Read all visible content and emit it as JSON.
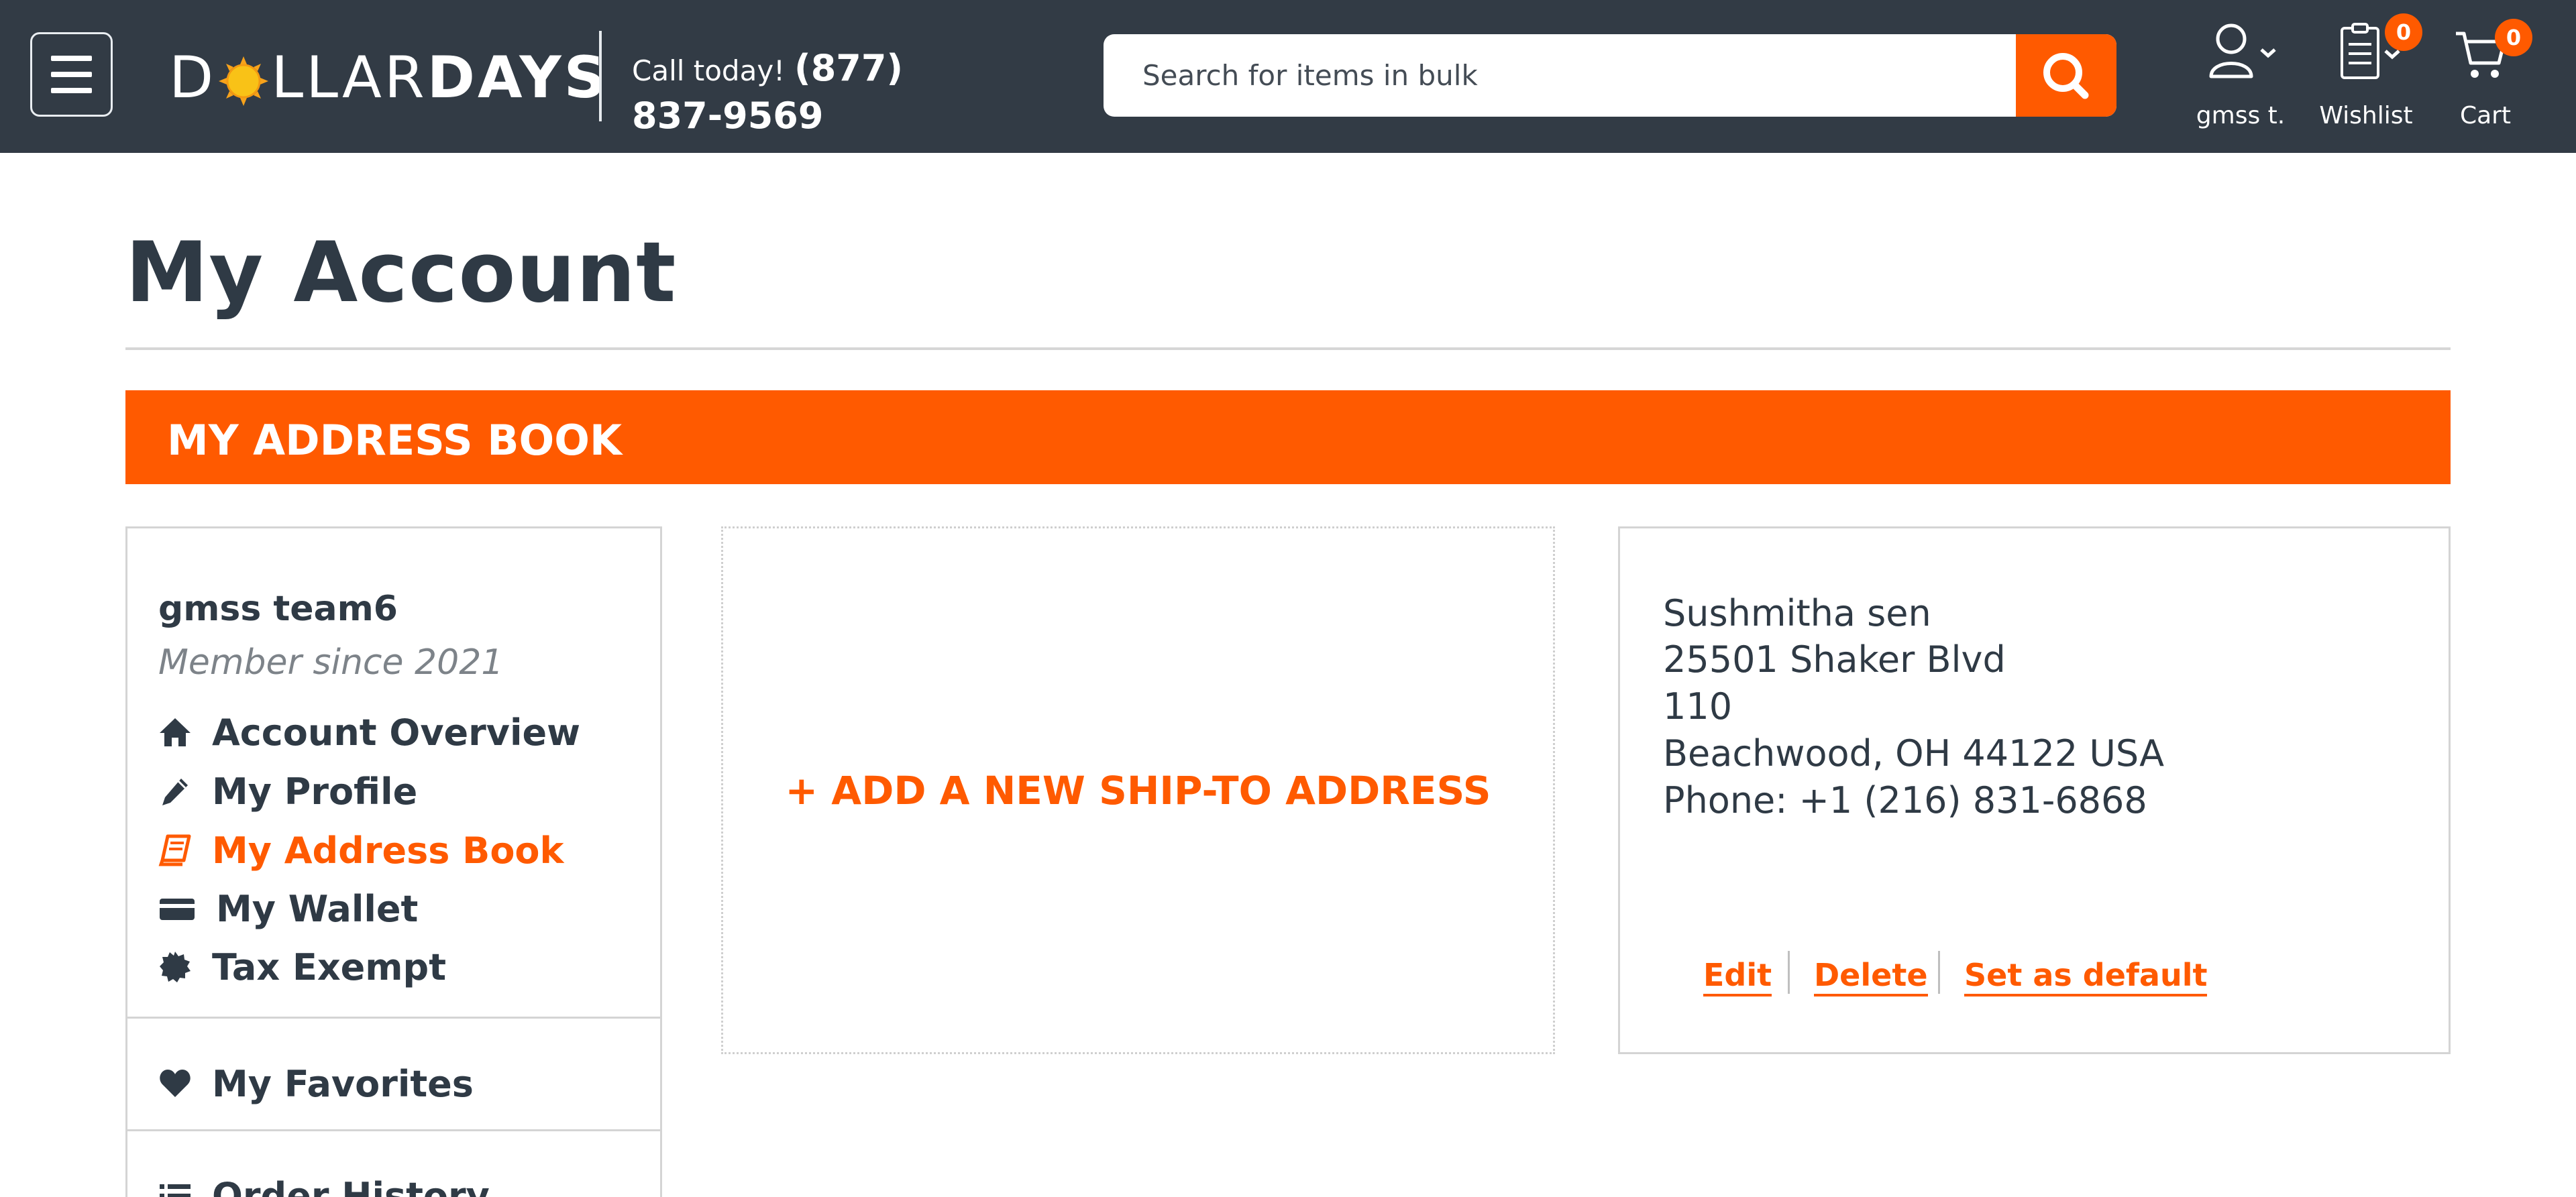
{
  "header": {
    "logo": {
      "part1": "D",
      "part2": "LLAR",
      "part3": "DAYS"
    },
    "call_label": "Call today!",
    "phone_part1": "(877)",
    "phone_part2": "837-9569",
    "search": {
      "placeholder": "Search for items in bulk"
    },
    "account_label": "gmss t.",
    "wishlist_label": "Wishlist",
    "wishlist_count": "0",
    "cart_label": "Cart",
    "cart_count": "0"
  },
  "page": {
    "title": "My Account",
    "section_title": "MY ADDRESS BOOK"
  },
  "sidebar": {
    "user_name": "gmss team6",
    "member_since": "Member since 2021",
    "items": [
      {
        "label": "Account Overview",
        "icon": "home-icon"
      },
      {
        "label": "My Profile",
        "icon": "pencil-icon"
      },
      {
        "label": "My Address Book",
        "icon": "book-icon",
        "active": true
      },
      {
        "label": "My Wallet",
        "icon": "credit-card-icon"
      },
      {
        "label": "Tax Exempt",
        "icon": "certificate-icon"
      }
    ],
    "favorites_label": "My Favorites",
    "order_history_label": "Order History"
  },
  "add_address_label": "+ ADD A NEW SHIP-TO ADDRESS",
  "address": {
    "name": "Sushmitha sen",
    "street": "25501 Shaker Blvd",
    "unit": "110",
    "city_line": "Beachwood, OH 44122 USA",
    "phone": "Phone: +1 (216) 831-6868",
    "actions": {
      "edit": "Edit",
      "delete": "Delete",
      "set_default": "Set as default"
    }
  },
  "colors": {
    "header_bg": "#323b45",
    "accent": "#ff5a00",
    "text": "#2f3a45"
  }
}
